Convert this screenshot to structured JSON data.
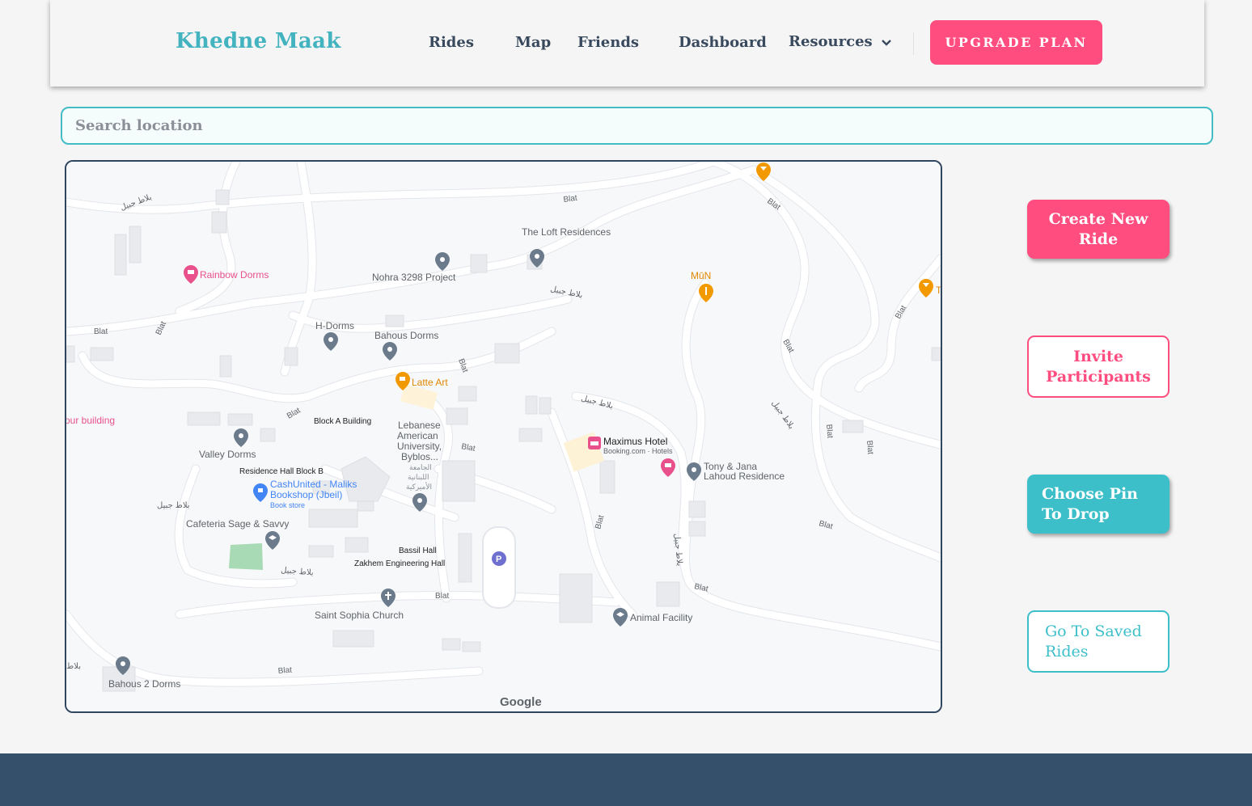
{
  "header": {
    "brand": "Khedne Maak",
    "nav": [
      "Rides",
      "Map",
      "Friends",
      "Dashboard",
      "Resources"
    ],
    "upgrade_label": "UPGRADE PLAN"
  },
  "search": {
    "placeholder": "Search location",
    "value": ""
  },
  "actions": {
    "create_new_ride": "Create New Ride",
    "invite_participants": "Invite Participants",
    "choose_pin": "Choose Pin To Drop",
    "saved_rides": "Go To Saved Rides"
  },
  "map": {
    "pois": {
      "loft": "The Loft Residences",
      "nohra": "Nohra 3298 Project",
      "rainbow": "Rainbow Dorms",
      "mun": "MūN",
      "hdorms": "H-Dorms",
      "bahous": "Bahous Dorms",
      "latte": "Latte Art",
      "your_building": "our building",
      "block_a": "Block A Building",
      "lau1": "Lebanese",
      "lau2": "American",
      "lau3": "University,",
      "lau4": "Byblos...",
      "lau_ar1": "الجامعة",
      "lau_ar2": "اللبنانية",
      "lau_ar3": "الأميركية",
      "maximus": "Maximus Hotel",
      "maximus_sub": "Booking.com · Hotels",
      "valley": "Valley Dorms",
      "res_hall": "Residence Hall Block B",
      "tony1": "Tony & Jana",
      "tony2": "Lahoud Residence",
      "cash1": "CashUnited - Maliks",
      "cash2": "Bookshop (Jbeil)",
      "cash_sub": "Book store",
      "cafeteria": "Cafeteria Sage & Savvy",
      "bassil": "Bassil Hall",
      "zakhem": "Zakhem Engineering Hall",
      "sophia": "Saint Sophia Church",
      "animal": "Animal Facility",
      "bahous2": "Bahous 2 Dorms",
      "t": "T"
    },
    "streets": {
      "blat": "Blat",
      "blat_ar": "بلاط جبيل",
      "blat_ar_short": "بلاط"
    },
    "attribution": "Google"
  },
  "colors": {
    "brand": "#43b3c0",
    "accent_pink": "#ff4d80",
    "accent_teal": "#3dbfc9",
    "footer": "#35506b",
    "map_border": "#2f4660"
  }
}
